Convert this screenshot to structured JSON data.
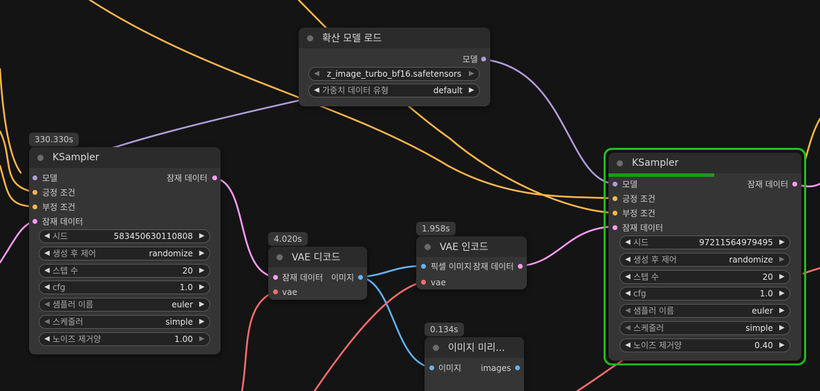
{
  "colors": {
    "background": "#141414",
    "model": "#b39ddb",
    "conditioning": "#ffb74d",
    "latent": "#ff9cf9",
    "vae": "#ff6e6e",
    "image": "#64b5f6",
    "selected_outline": "#1ec41e",
    "progress": "#1d9a1d"
  },
  "icons": {
    "left": "triangle-left-icon",
    "right": "triangle-right-icon",
    "status": "status-dot-icon"
  },
  "nodes": {
    "model_loader": {
      "title": "확산 모델 로드",
      "output_model": "모델",
      "unet_name": "z_image_turbo_bf16.safetensors",
      "weight_dtype_label": "가중치 데이터 유형",
      "weight_dtype_value": "default"
    },
    "ksampler1": {
      "timing": "330.330s",
      "title": "KSampler",
      "input_model": "모델",
      "input_positive": "긍정 조건",
      "input_negative": "부정 조건",
      "input_latent": "잠재 데이터",
      "output_latent": "잠재 데이터",
      "widgets": [
        {
          "label": "시드",
          "value": "583450630110808"
        },
        {
          "label": "생성 후 제어",
          "value": "randomize"
        },
        {
          "label": "스텝 수",
          "value": "20"
        },
        {
          "label": "cfg",
          "value": "1.0"
        },
        {
          "label": "샘플러 이름",
          "value": "euler"
        },
        {
          "label": "스케줄러",
          "value": "simple"
        },
        {
          "label": "노이즈 제거양",
          "value": "1.00"
        }
      ]
    },
    "vae_decode": {
      "timing": "4.020s",
      "title": "VAE 디코드",
      "input_latent": "잠재 데이터",
      "input_vae": "vae",
      "output_image": "이미지"
    },
    "vae_encode": {
      "timing": "1.958s",
      "title": "VAE 인코드",
      "input_pixels": "픽셀 이미지",
      "input_vae": "vae",
      "output_latent": "잠재 데이터"
    },
    "preview": {
      "timing": "0.134s",
      "title": "이미지 미리...",
      "input_images": "이미지",
      "output_images": "images"
    },
    "ksampler2": {
      "title": "KSampler",
      "progress": 0.55,
      "input_model": "모델",
      "input_positive": "긍정 조건",
      "input_negative": "부정 조건",
      "input_latent": "잠재 데이터",
      "output_latent": "잠재 데이터",
      "widgets": [
        {
          "label": "시드",
          "value": "97211564979495"
        },
        {
          "label": "생성 후 제어",
          "value": "randomize"
        },
        {
          "label": "스텝 수",
          "value": "20"
        },
        {
          "label": "cfg",
          "value": "1.0"
        },
        {
          "label": "샘플러 이름",
          "value": "euler"
        },
        {
          "label": "스케줄러",
          "value": "simple"
        },
        {
          "label": "노이즈 제거양",
          "value": "0.40"
        }
      ]
    }
  }
}
